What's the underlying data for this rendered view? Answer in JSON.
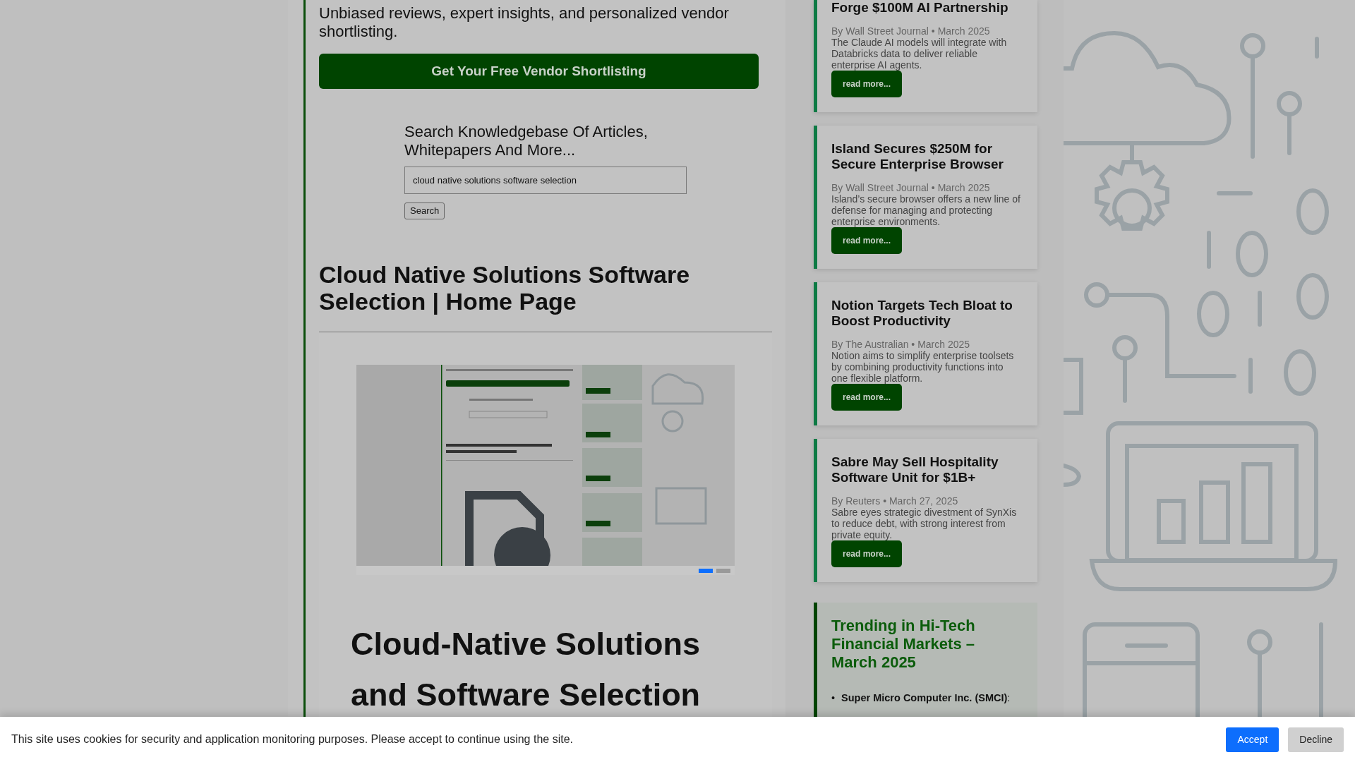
{
  "intro": {
    "tagline": "Unbiased reviews, expert insights, and personalized vendor shortlisting.",
    "cta_button": "Get Your Free Vendor Shortlisting"
  },
  "search": {
    "heading": "Search Knowledgebase Of Articles, Whitepapers And More...",
    "value": "cloud native solutions software selection",
    "button": "Search"
  },
  "page_title": "Cloud Native Solutions Software Selection | Home Page",
  "article": {
    "heading": "Cloud-Native Solutions and Software Selection"
  },
  "news": [
    {
      "title": "Forge $100M AI Partnership",
      "byline": "By Wall Street Journal • March 2025",
      "summary": "The Claude AI models will integrate with Databricks data to deliver reliable enterprise AI agents.",
      "button": "read more..."
    },
    {
      "title": "Island Secures $250M for Secure Enterprise Browser",
      "byline": "By Wall Street Journal • March 2025",
      "summary": "Island’s secure browser offers a new line of defense for managing and protecting enterprise environments.",
      "button": "read more..."
    },
    {
      "title": "Notion Targets Tech Bloat to Boost Productivity",
      "byline": "By The Australian • March 2025",
      "summary": "Notion aims to simplify enterprise toolsets by combining productivity functions into one flexible platform.",
      "button": "read more..."
    },
    {
      "title": "Sabre May Sell Hospitality Software Unit for $1B+",
      "byline": "By Reuters • March 27, 2025",
      "summary": "Sabre eyes strategic divestment of SynXis to reduce debt, with strong interest from private equity.",
      "button": "read more..."
    }
  ],
  "trending": {
    "title": "Trending in Hi-Tech Financial Markets – March 2025",
    "items": [
      {
        "marker": "•",
        "text": "**Super Micro Computer Inc. (SMCI)**:"
      }
    ]
  },
  "cookie_bar": {
    "message": "This site uses cookies for security and application monitoring purposes. Please accept to continue using the site.",
    "buttons": [
      {
        "label": "Accept",
        "kind": "primary"
      },
      {
        "label": "Decline",
        "kind": "secondary"
      }
    ]
  }
}
